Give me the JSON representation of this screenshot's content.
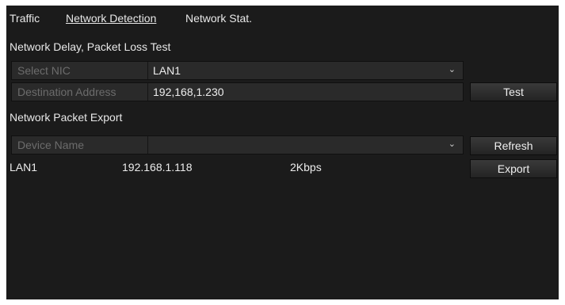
{
  "tabs": [
    {
      "label": "Traffic",
      "active": false
    },
    {
      "label": "Network Detection",
      "active": true
    },
    {
      "label": "Network Stat.",
      "active": false
    }
  ],
  "delay_test": {
    "title": "Network Delay, Packet Loss Test",
    "nic_label": "Select NIC",
    "nic_value": "LAN1",
    "dest_label": "Destination Address",
    "dest_value": "192,168,1.230",
    "test_button": "Test"
  },
  "packet_export": {
    "title": "Network Packet Export",
    "device_label": "Device Name",
    "device_value": "",
    "refresh_button": "Refresh",
    "export_button": "Export",
    "rows": [
      {
        "name": "LAN1",
        "ip": "192.168.1.118",
        "rate": "2Kbps"
      }
    ]
  },
  "icons": {
    "dropdown": "chevron-down-icon"
  },
  "colors": {
    "background": "#1b1b1b",
    "field": "#2a2a2a",
    "label_muted": "#6c6c6c"
  }
}
